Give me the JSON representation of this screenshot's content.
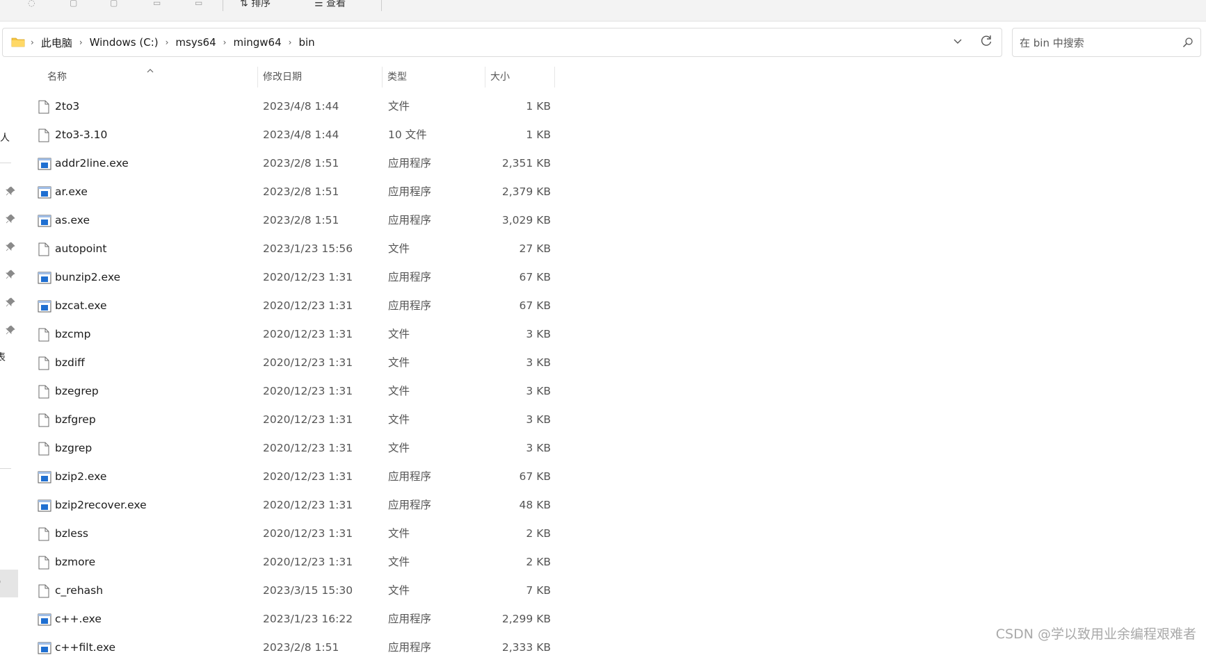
{
  "toolbar": {
    "sort_label": "排序",
    "view_label": "查看"
  },
  "address": {
    "crumbs": [
      "此电脑",
      "Windows (C:)",
      "msys64",
      "mingw64",
      "bin"
    ]
  },
  "search": {
    "placeholder": "在 bin 中搜索"
  },
  "sidebar": {
    "partial_label_1": "人",
    "partial_label_2": "表",
    "partial_label_3": ")"
  },
  "columns": {
    "name": "名称",
    "date": "修改日期",
    "type": "类型",
    "size": "大小"
  },
  "files": [
    {
      "name": "2to3",
      "date": "2023/4/8 1:44",
      "type": "文件",
      "size": "1 KB",
      "icon": "file-icon"
    },
    {
      "name": "2to3-3.10",
      "date": "2023/4/8 1:44",
      "type": "10 文件",
      "size": "1 KB",
      "icon": "file-icon"
    },
    {
      "name": "addr2line.exe",
      "date": "2023/2/8 1:51",
      "type": "应用程序",
      "size": "2,351 KB",
      "icon": "exe-icon"
    },
    {
      "name": "ar.exe",
      "date": "2023/2/8 1:51",
      "type": "应用程序",
      "size": "2,379 KB",
      "icon": "exe-icon"
    },
    {
      "name": "as.exe",
      "date": "2023/2/8 1:51",
      "type": "应用程序",
      "size": "3,029 KB",
      "icon": "exe-icon"
    },
    {
      "name": "autopoint",
      "date": "2023/1/23 15:56",
      "type": "文件",
      "size": "27 KB",
      "icon": "file-icon"
    },
    {
      "name": "bunzip2.exe",
      "date": "2020/12/23 1:31",
      "type": "应用程序",
      "size": "67 KB",
      "icon": "exe-icon"
    },
    {
      "name": "bzcat.exe",
      "date": "2020/12/23 1:31",
      "type": "应用程序",
      "size": "67 KB",
      "icon": "exe-icon"
    },
    {
      "name": "bzcmp",
      "date": "2020/12/23 1:31",
      "type": "文件",
      "size": "3 KB",
      "icon": "file-icon"
    },
    {
      "name": "bzdiff",
      "date": "2020/12/23 1:31",
      "type": "文件",
      "size": "3 KB",
      "icon": "file-icon"
    },
    {
      "name": "bzegrep",
      "date": "2020/12/23 1:31",
      "type": "文件",
      "size": "3 KB",
      "icon": "file-icon"
    },
    {
      "name": "bzfgrep",
      "date": "2020/12/23 1:31",
      "type": "文件",
      "size": "3 KB",
      "icon": "file-icon"
    },
    {
      "name": "bzgrep",
      "date": "2020/12/23 1:31",
      "type": "文件",
      "size": "3 KB",
      "icon": "file-icon"
    },
    {
      "name": "bzip2.exe",
      "date": "2020/12/23 1:31",
      "type": "应用程序",
      "size": "67 KB",
      "icon": "exe-icon"
    },
    {
      "name": "bzip2recover.exe",
      "date": "2020/12/23 1:31",
      "type": "应用程序",
      "size": "48 KB",
      "icon": "exe-icon"
    },
    {
      "name": "bzless",
      "date": "2020/12/23 1:31",
      "type": "文件",
      "size": "2 KB",
      "icon": "file-icon"
    },
    {
      "name": "bzmore",
      "date": "2020/12/23 1:31",
      "type": "文件",
      "size": "2 KB",
      "icon": "file-icon"
    },
    {
      "name": "c_rehash",
      "date": "2023/3/15 15:30",
      "type": "文件",
      "size": "7 KB",
      "icon": "file-icon"
    },
    {
      "name": "c++.exe",
      "date": "2023/1/23 16:22",
      "type": "应用程序",
      "size": "2,299 KB",
      "icon": "exe-icon"
    },
    {
      "name": "c++filt.exe",
      "date": "2023/2/8 1:51",
      "type": "应用程序",
      "size": "2,333 KB",
      "icon": "exe-icon"
    }
  ],
  "watermark": "CSDN @学以致用业余编程艰难者",
  "colors": {
    "exe_blue": "#1f6fd1",
    "folder_yellow": "#f4c542"
  }
}
